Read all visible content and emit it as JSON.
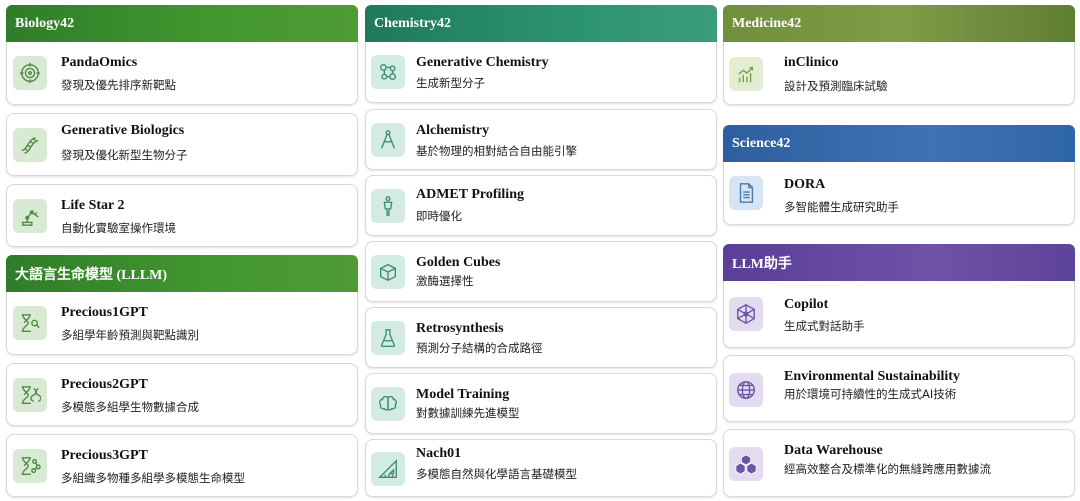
{
  "colors": {
    "green": "#3f8f2f",
    "teal": "#2c9371",
    "olive": "#7f9c47",
    "blue": "#3d73b4",
    "purple": "#6f52a8"
  },
  "biology": {
    "header": "Biology42",
    "items": [
      {
        "title": "PandaOmics",
        "subtitle": "發現及優先排序新靶點",
        "icon": "target-icon"
      },
      {
        "title": "Generative Biologics",
        "subtitle": "發現及優化新型生物分子",
        "icon": "dna-icon"
      },
      {
        "title": "Life Star 2",
        "subtitle": "自動化實驗室操作環境",
        "icon": "robot-arm-icon"
      }
    ]
  },
  "llm_left": {
    "header": "大語言生命模型 (LLLM)",
    "items": [
      {
        "title": "Precious1GPT",
        "subtitle": "多組學年齡預測與靶點識別",
        "icon": "hourglass-search-icon"
      },
      {
        "title": "Precious2GPT",
        "subtitle": "多模態多組學生物數據合成",
        "icon": "hourglass-dna-icon"
      },
      {
        "title": "Precious3GPT",
        "subtitle": "多組織多物種多組學多模態生命模型",
        "icon": "hourglass-molecule-icon"
      }
    ]
  },
  "chemistry": {
    "header": "Chemistry42",
    "items": [
      {
        "title": "Generative Chemistry",
        "subtitle": "生成新型分子",
        "icon": "molecule-icon"
      },
      {
        "title": "Alchemistry",
        "subtitle": "基於物理的相對結合自由能引擎",
        "icon": "compass-icon"
      },
      {
        "title": "ADMET Profiling",
        "subtitle": "即時優化",
        "icon": "human-body-icon"
      },
      {
        "title": "Golden Cubes",
        "subtitle": "激酶選擇性",
        "icon": "cube-icon"
      },
      {
        "title": "Retrosynthesis",
        "subtitle": "預測分子結構的合成路徑",
        "icon": "beaker-icon"
      },
      {
        "title": "Model Training",
        "subtitle": "對數據訓練先進模型",
        "icon": "brain-icon"
      },
      {
        "title": "Nach01",
        "subtitle": "多模態自然與化學語言基礎模型",
        "icon": "ruler-triangle-icon"
      }
    ]
  },
  "medicine": {
    "header": "Medicine42",
    "items": [
      {
        "title": "inClinico",
        "subtitle": "設計及預測臨床試驗",
        "icon": "bar-chart-icon"
      }
    ]
  },
  "science": {
    "header": "Science42",
    "items": [
      {
        "title": "DORA",
        "subtitle": "多智能體生成研究助手",
        "icon": "document-icon"
      }
    ]
  },
  "llm_right": {
    "header": "LLM助手",
    "items": [
      {
        "title": "Copilot",
        "subtitle": "生成式對話助手",
        "icon": "network-icon"
      },
      {
        "title": "Environmental Sustainability",
        "subtitle": "用於環境可持續性的生成式AI技術",
        "icon": "globe-icon"
      },
      {
        "title": "Data Warehouse",
        "subtitle": "經高效整合及標準化的無縫跨應用數據流",
        "icon": "cubes-icon"
      }
    ]
  }
}
